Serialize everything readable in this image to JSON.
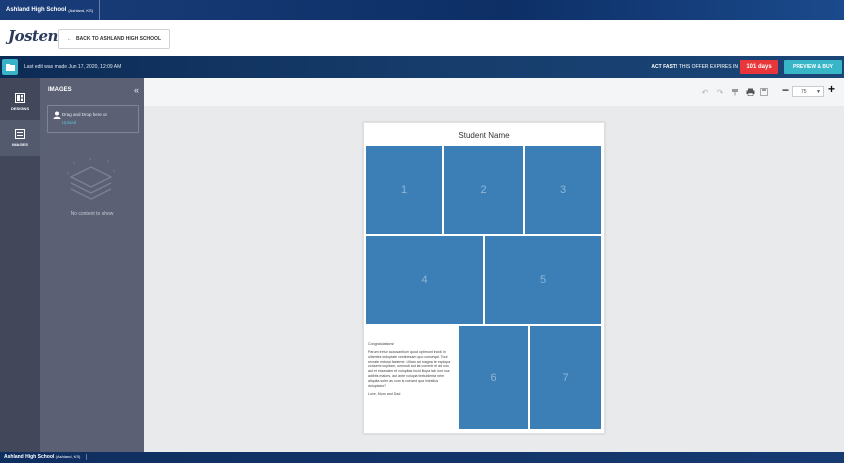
{
  "top_bar": {
    "school": "Ashland High School",
    "location": "(Ashland, KS)"
  },
  "header": {
    "logo": "Jostens",
    "back_label": "BACK TO ASHLAND HIGH SCHOOL"
  },
  "status_bar": {
    "last_edit": "Last edit was made Jun 17, 2020, 12:09 AM",
    "offer_bold": "ACT FAST!",
    "offer_text": " THIS OFFER EXPIRES IN",
    "days": "101 days",
    "preview_label": "PREVIEW & BUY"
  },
  "left_rail": {
    "items": [
      {
        "label": "DESIGNS",
        "icon": "designs-icon"
      },
      {
        "label": "IMAGES",
        "icon": "images-icon"
      }
    ]
  },
  "images_panel": {
    "title": "IMAGES",
    "drop_text": "Drag and Drop here or",
    "upload_link": "Upload",
    "empty_text": "No content to show"
  },
  "toolbar": {
    "zoom": "75"
  },
  "page": {
    "title": "Student Name",
    "slots": [
      "1",
      "2",
      "3",
      "4",
      "5",
      "6",
      "7"
    ],
    "message": {
      "greeting": "Congratulations!",
      "body": "Parum iretur accusantium quod optimunt incidi in ullamtes doluptate vestinesam quo conseqai. Tout recrate estusa fasteme. Ullam ad magna te explopa consemi cupitam, ommodi aut lat commit et ad nos aut et essecaim et volupitas incid illupa lab iunt nus adibits maiors, aut ante volupia textuidenta nem aliquita soler as cum is nonsed qua iniestius doluptatur?",
      "signature": "Love, Mom and Dad"
    }
  },
  "bottom_bar": {
    "school": "Ashland High School",
    "location": "(Ashland, KS)"
  },
  "colors": {
    "slot_blue": "#3b7fb6",
    "accent_teal": "#38b6c7",
    "alert_red": "#e8363a",
    "panel": "#5b6074"
  }
}
